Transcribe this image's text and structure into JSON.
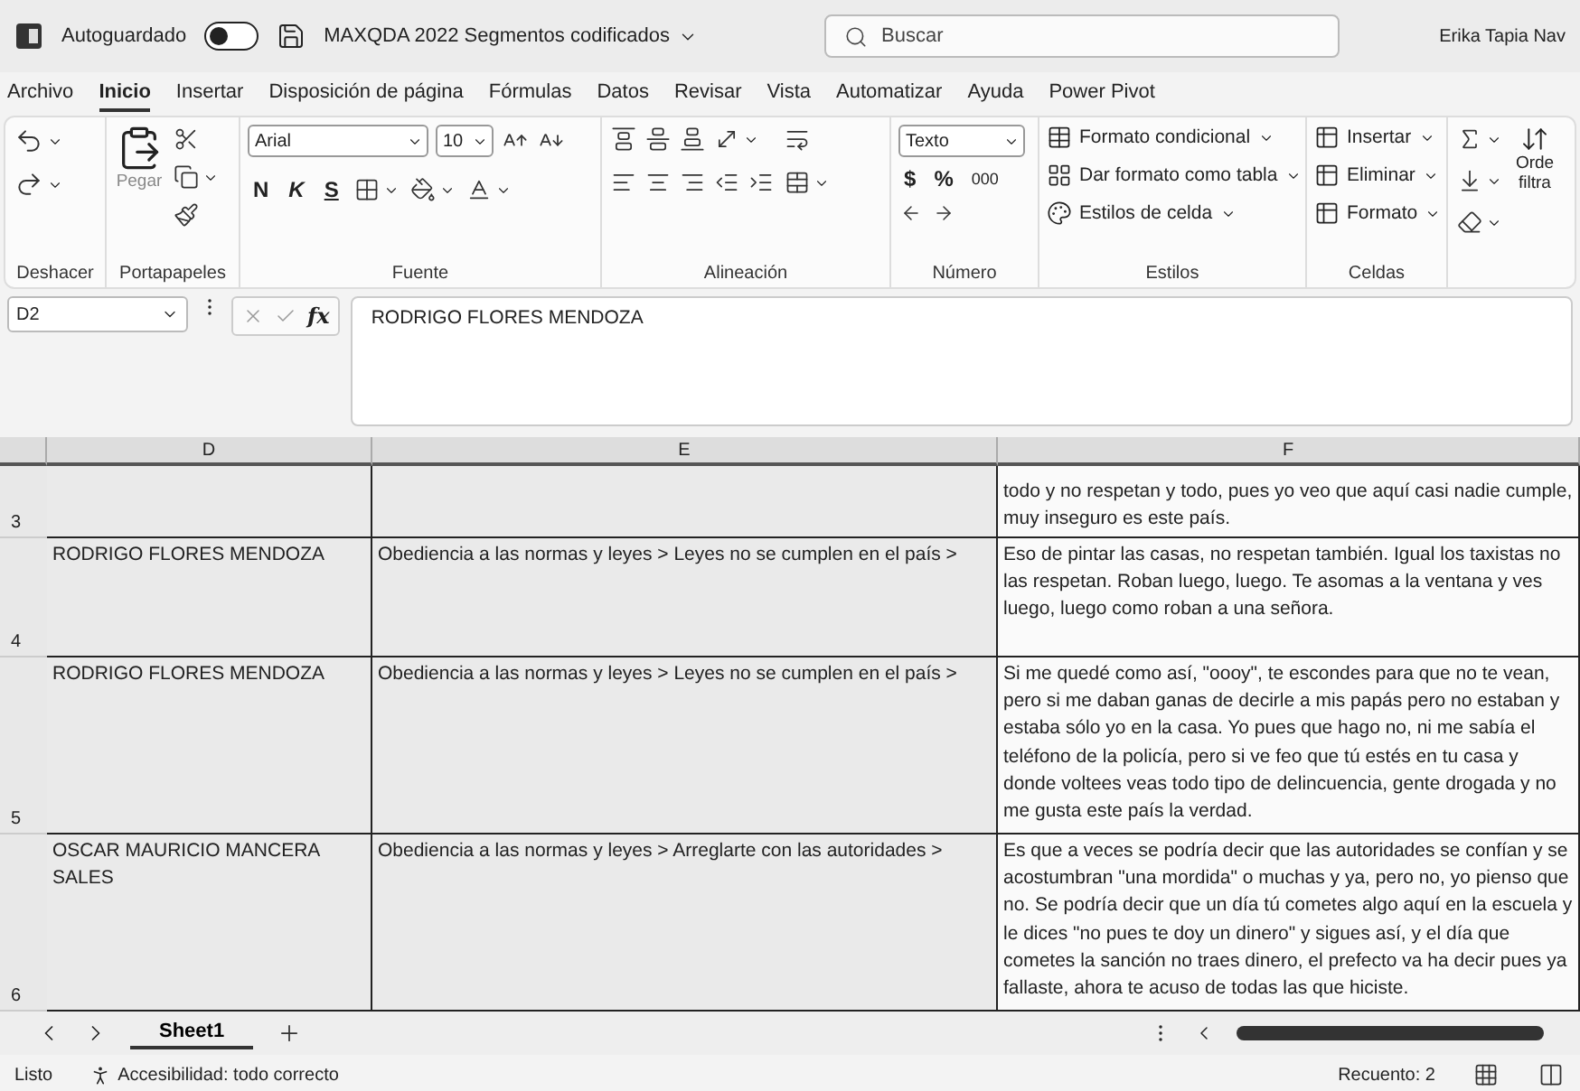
{
  "title_bar": {
    "autosave_label": "Autoguardado",
    "autosave_on": false,
    "document_title": "MAXQDA 2022 Segmentos codificados",
    "search_placeholder": "Buscar",
    "user": "Erika Tapia Nav"
  },
  "ribbon_tabs": [
    {
      "label": "Archivo",
      "selected": false
    },
    {
      "label": "Inicio",
      "selected": true
    },
    {
      "label": "Insertar",
      "selected": false
    },
    {
      "label": "Disposición de página",
      "selected": false
    },
    {
      "label": "Fórmulas",
      "selected": false
    },
    {
      "label": "Datos",
      "selected": false
    },
    {
      "label": "Revisar",
      "selected": false
    },
    {
      "label": "Vista",
      "selected": false
    },
    {
      "label": "Automatizar",
      "selected": false
    },
    {
      "label": "Ayuda",
      "selected": false
    },
    {
      "label": "Power Pivot",
      "selected": false
    }
  ],
  "ribbon": {
    "undo": {
      "label": "Deshacer"
    },
    "clipboard": {
      "paste": "Pegar",
      "label": "Portapapeles"
    },
    "font": {
      "name": "Arial",
      "size": "10",
      "bold": "N",
      "italic": "K",
      "underline": "S",
      "label": "Fuente"
    },
    "alignment": {
      "label": "Alineación"
    },
    "number": {
      "format": "Texto",
      "currency": "$",
      "percent": "%",
      "thousands": "000",
      "label": "Número"
    },
    "styles": {
      "items": [
        "Formato condicional",
        "Dar formato como tabla",
        "Estilos de celda"
      ],
      "label": "Estilos"
    },
    "cells": {
      "items": [
        "Insertar",
        "Eliminar",
        "Formato"
      ],
      "label": "Celdas"
    },
    "editing": {
      "sort_label": "Orde filtra"
    }
  },
  "formula_bar": {
    "name_box": "D2",
    "function_label": "fx",
    "value": "RODRIGO FLORES MENDOZA"
  },
  "sheet": {
    "columns": [
      "D",
      "E",
      "F"
    ],
    "rows": [
      {
        "number": "3",
        "cells": [
          "",
          "",
          "todo y no respetan y todo, pues yo veo que aquí casi nadie cumple, muy inseguro es este país."
        ]
      },
      {
        "number": "4",
        "cells": [
          "RODRIGO FLORES MENDOZA",
          "Obediencia a las normas y leyes > Leyes no se cumplen en el país >",
          "Eso de pintar las casas, no respetan también. Igual los taxistas no las respetan. Roban luego, luego. Te asomas a la ventana y ves luego, luego como roban a una señora."
        ]
      },
      {
        "number": "5",
        "cells": [
          "RODRIGO FLORES MENDOZA",
          "Obediencia a las normas y leyes > Leyes no se cumplen en el país >",
          "Si me quedé como así, \"oooy\", te escondes para que no te vean, pero si me daban ganas de decirle a mis papás pero no estaban y estaba sólo yo en la casa. Yo pues que hago no, ni me sabía el teléfono de la policía, pero si ve feo que tú estés en tu casa y donde voltees veas todo tipo de delincuencia, gente drogada y no me gusta este país la verdad."
        ]
      },
      {
        "number": "6",
        "cells": [
          "OSCAR MAURICIO MANCERA SALES",
          "Obediencia a las normas y leyes > Arreglarte con las autoridades >",
          "Es que a veces se podría decir que las autoridades se confían y se acostumbran \"una mordida\" o muchas y ya, pero no, yo pienso que no. Se podría decir que un día tú cometes algo aquí en la escuela y le dices \"no pues te doy un dinero\" y sigues así, y el día que cometes la sanción no traes dinero, el prefecto va ha decir pues ya fallaste, ahora te acuso de todas las que hiciste."
        ]
      }
    ]
  },
  "sheet_tabs": [
    {
      "label": "Sheet1",
      "selected": true
    }
  ],
  "status_bar": {
    "ready": "Listo",
    "accessibility": "Accesibilidad: todo correcto",
    "count": "Recuento: 2"
  }
}
